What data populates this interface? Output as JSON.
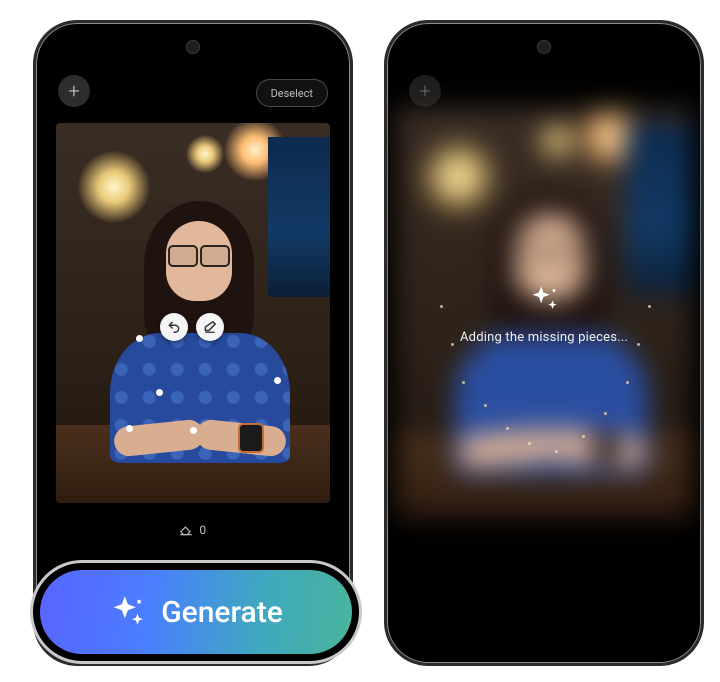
{
  "left_phone": {
    "add_btn_glyph": "+",
    "deselect_label": "Deselect",
    "undo_icon": "undo-icon",
    "erase_icon": "erase-icon",
    "erase_count_value": "0"
  },
  "right_phone": {
    "add_btn_glyph": "+",
    "status_text": "Adding the missing pieces..."
  },
  "generate_button": {
    "label": "Generate"
  },
  "colors": {
    "gradient_start": "#5865ff",
    "gradient_end": "#49b49c"
  }
}
